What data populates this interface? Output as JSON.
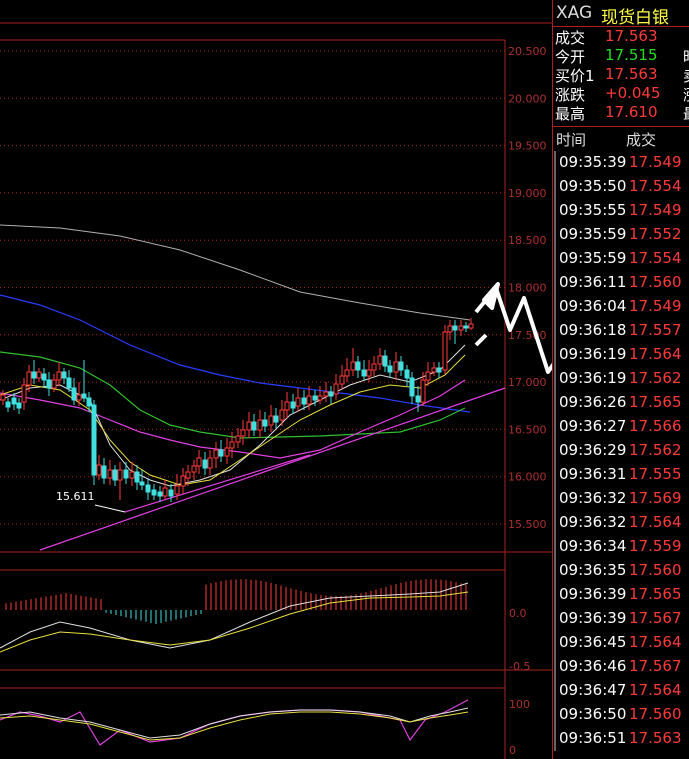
{
  "header": {
    "symbol": "XAG",
    "name": "现货白银"
  },
  "quote": [
    {
      "label": "成交",
      "value": "17.563",
      "color": "red",
      "cut": ""
    },
    {
      "label": "今开",
      "value": "17.515",
      "color": "green",
      "cut": "昨"
    },
    {
      "label": "买价1",
      "value": "17.563",
      "color": "red",
      "cut": "卖"
    },
    {
      "label": "涨跌",
      "value": "+0.045",
      "color": "red",
      "cut": "涨"
    },
    {
      "label": "最高",
      "value": "17.610",
      "color": "red",
      "cut": "最"
    }
  ],
  "ticks_header": {
    "time": "时间",
    "price": "成交"
  },
  "ticks": [
    {
      "time": "09:35:39",
      "price": "17.549"
    },
    {
      "time": "09:35:50",
      "price": "17.554"
    },
    {
      "time": "09:35:55",
      "price": "17.549"
    },
    {
      "time": "09:35:59",
      "price": "17.552"
    },
    {
      "time": "09:35:59",
      "price": "17.554"
    },
    {
      "time": "09:36:11",
      "price": "17.560"
    },
    {
      "time": "09:36:04",
      "price": "17.549"
    },
    {
      "time": "09:36:18",
      "price": "17.557"
    },
    {
      "time": "09:36:19",
      "price": "17.564"
    },
    {
      "time": "09:36:19",
      "price": "17.562"
    },
    {
      "time": "09:36:26",
      "price": "17.565"
    },
    {
      "time": "09:36:27",
      "price": "17.566"
    },
    {
      "time": "09:36:29",
      "price": "17.562"
    },
    {
      "time": "09:36:31",
      "price": "17.555"
    },
    {
      "time": "09:36:32",
      "price": "17.569"
    },
    {
      "time": "09:36:32",
      "price": "17.564"
    },
    {
      "time": "09:36:34",
      "price": "17.559"
    },
    {
      "time": "09:36:35",
      "price": "17.560"
    },
    {
      "time": "09:36:39",
      "price": "17.565"
    },
    {
      "time": "09:36:39",
      "price": "17.567"
    },
    {
      "time": "09:36:45",
      "price": "17.564"
    },
    {
      "time": "09:36:46",
      "price": "17.567"
    },
    {
      "time": "09:36:47",
      "price": "17.564"
    },
    {
      "time": "09:36:50",
      "price": "17.560"
    },
    {
      "time": "09:36:51",
      "price": "17.563"
    }
  ],
  "price_axis": [
    "20.500",
    "20.000",
    "19.500",
    "19.000",
    "18.500",
    "18.000",
    "17.500",
    "17.000",
    "16.500",
    "16.000",
    "15.500"
  ],
  "low_marker": "15.611",
  "macd_axis": [
    "0.0",
    "-0.5"
  ],
  "kdj_axis": [
    "100",
    "0"
  ],
  "colors": {
    "up": "#ff3a3a",
    "down": "#40e0e0",
    "grid": "#aa2020"
  }
}
